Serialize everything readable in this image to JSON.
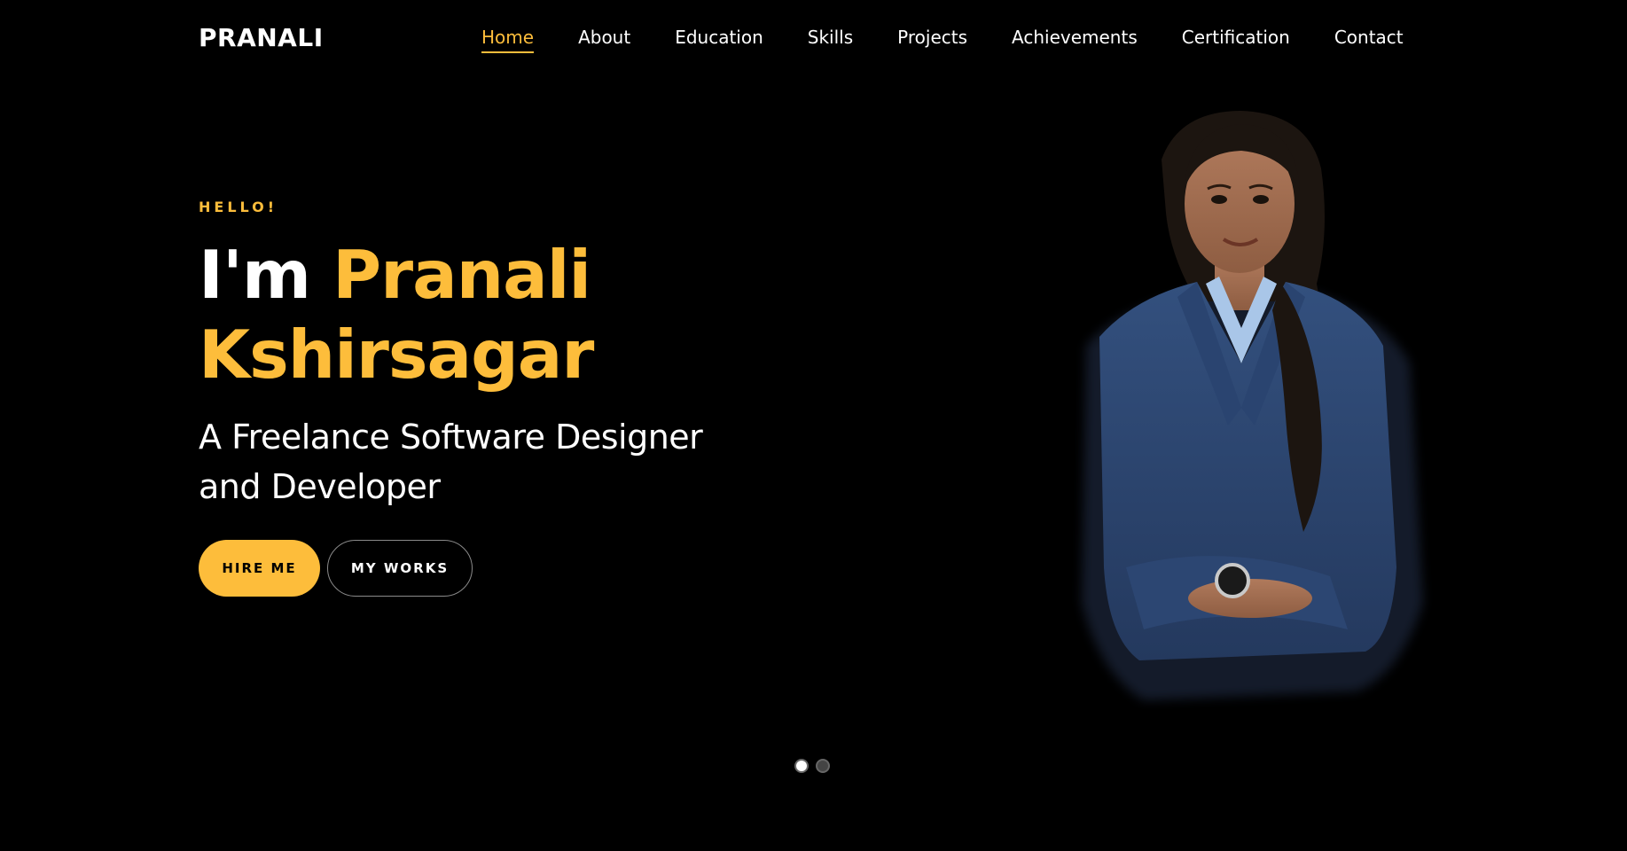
{
  "brand": {
    "name": "PRANALI"
  },
  "nav": {
    "items": [
      {
        "label": "Home",
        "active": true
      },
      {
        "label": "About"
      },
      {
        "label": "Education"
      },
      {
        "label": "Skills"
      },
      {
        "label": "Projects"
      },
      {
        "label": "Achievements"
      },
      {
        "label": "Certification"
      },
      {
        "label": "Contact"
      }
    ]
  },
  "hero": {
    "greeting": "HELLO!",
    "im": "I'm",
    "first_name": "Pranali",
    "last_name": "Kshirsagar",
    "subtitle_line1": "A Freelance Software Designer",
    "subtitle_line2": "and Developer",
    "hire_label": "HIRE ME",
    "works_label": "MY WORKS"
  },
  "carousel": {
    "count": 2,
    "active_index": 0
  },
  "colors": {
    "accent": "#fdbd3b",
    "background": "#000000",
    "text": "#ffffff"
  }
}
